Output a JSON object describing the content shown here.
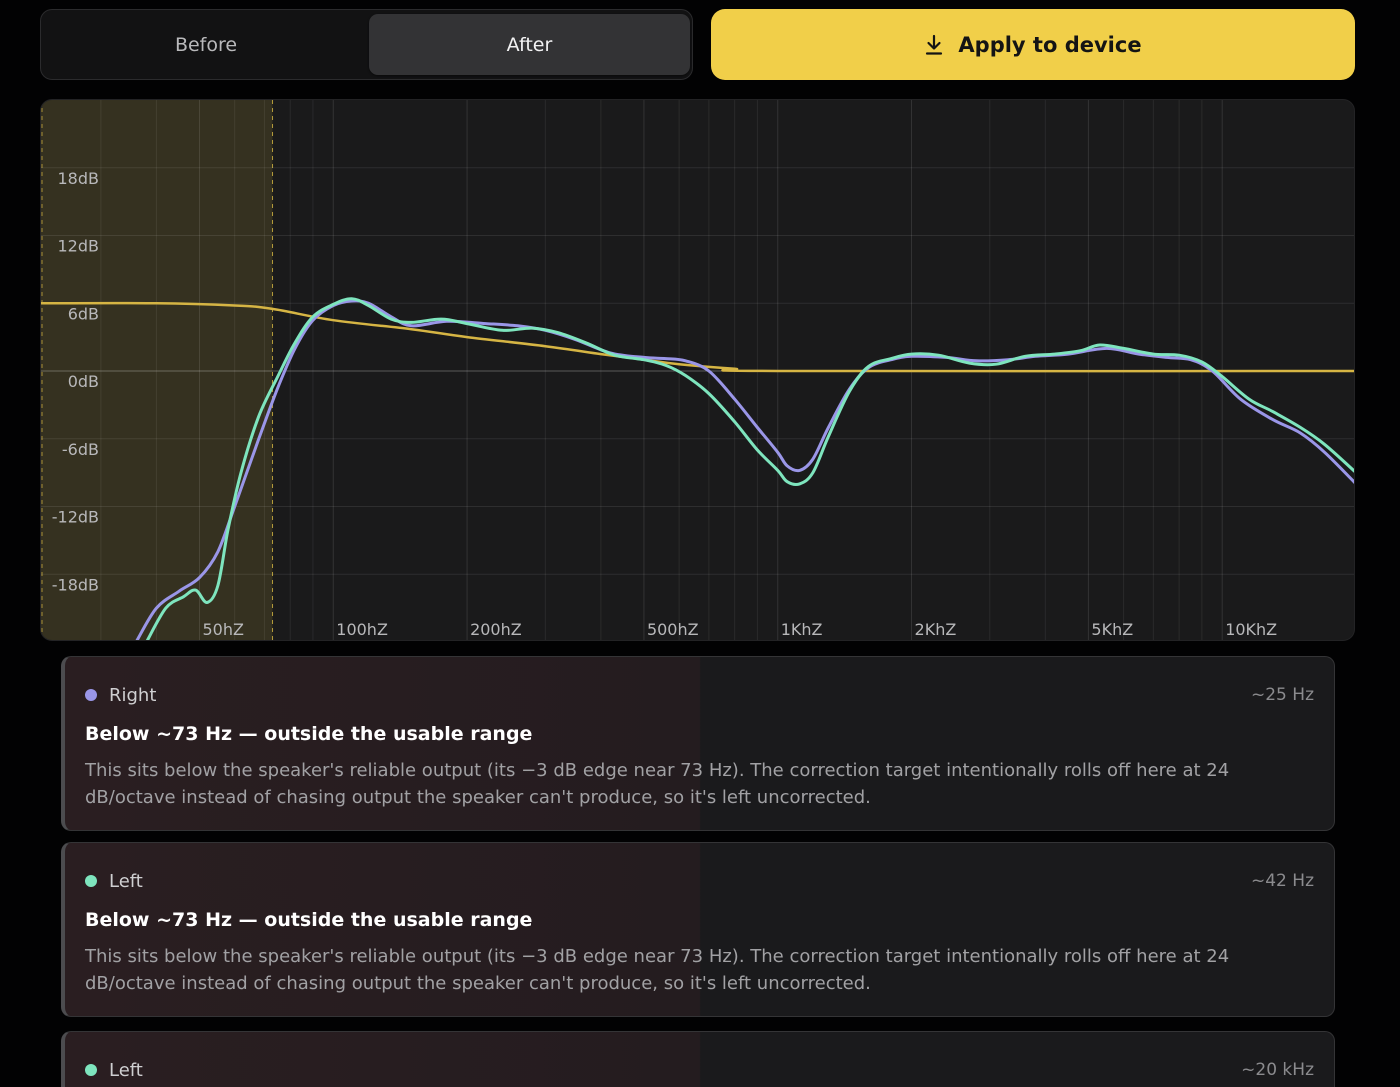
{
  "toggle": {
    "before": "Before",
    "after": "After",
    "selected": "After"
  },
  "apply_button": {
    "label": "Apply to device",
    "icon": "download-icon",
    "color": "#f1cf49"
  },
  "chart_data": {
    "type": "line",
    "x_scale": "log",
    "xlim": [
      22,
      20000
    ],
    "ylim": [
      -24,
      24
    ],
    "y_ticks": [
      {
        "value": 18,
        "label": "18dB"
      },
      {
        "value": 12,
        "label": "12dB"
      },
      {
        "value": 6,
        "label": "6dB"
      },
      {
        "value": 0,
        "label": "0dB"
      },
      {
        "value": -6,
        "label": "-6dB"
      },
      {
        "value": -12,
        "label": "-12dB"
      },
      {
        "value": -18,
        "label": "-18dB"
      }
    ],
    "x_ticks": [
      {
        "value": 50,
        "label": "50hZ"
      },
      {
        "value": 100,
        "label": "100hZ"
      },
      {
        "value": 200,
        "label": "200hZ"
      },
      {
        "value": 500,
        "label": "500hZ"
      },
      {
        "value": 1000,
        "label": "1KhZ"
      },
      {
        "value": 2000,
        "label": "2KhZ"
      },
      {
        "value": 5000,
        "label": "5KhZ"
      },
      {
        "value": 10000,
        "label": "10KhZ"
      }
    ],
    "minor_grid": [
      30,
      40,
      60,
      70,
      80,
      90,
      300,
      400,
      600,
      700,
      800,
      900,
      3000,
      4000,
      6000,
      7000,
      8000,
      9000
    ],
    "grid": true,
    "shaded_region": {
      "from": 22,
      "to": 73,
      "color": "#f1cf49"
    },
    "series": [
      {
        "color": "#d6b544",
        "points": [
          [
            22,
            6
          ],
          [
            40,
            6
          ],
          [
            60,
            5.8
          ],
          [
            73,
            5.5
          ],
          [
            100,
            4.5
          ],
          [
            150,
            3.7
          ],
          [
            200,
            3.0
          ],
          [
            300,
            2.2
          ],
          [
            400,
            1.5
          ],
          [
            500,
            1.0
          ],
          [
            600,
            0.6
          ],
          [
            800,
            0.2
          ],
          [
            1000,
            0
          ],
          [
            20000,
            0
          ]
        ]
      },
      {
        "color": "#9a96e8",
        "points": [
          [
            36,
            -24
          ],
          [
            40,
            -21
          ],
          [
            45,
            -19.5
          ],
          [
            50,
            -18.3
          ],
          [
            55,
            -16
          ],
          [
            60,
            -12
          ],
          [
            68,
            -6
          ],
          [
            75,
            -1.5
          ],
          [
            82,
            2
          ],
          [
            90,
            4.5
          ],
          [
            100,
            5.8
          ],
          [
            110,
            6.2
          ],
          [
            120,
            6.0
          ],
          [
            135,
            4.8
          ],
          [
            150,
            4.0
          ],
          [
            180,
            4.4
          ],
          [
            220,
            4.2
          ],
          [
            260,
            4.0
          ],
          [
            300,
            3.6
          ],
          [
            350,
            2.8
          ],
          [
            420,
            1.6
          ],
          [
            500,
            1.2
          ],
          [
            560,
            1.1
          ],
          [
            620,
            0.9
          ],
          [
            700,
            0
          ],
          [
            800,
            -2.5
          ],
          [
            900,
            -5
          ],
          [
            1000,
            -7.2
          ],
          [
            1050,
            -8.4
          ],
          [
            1120,
            -8.8
          ],
          [
            1200,
            -7.8
          ],
          [
            1300,
            -5
          ],
          [
            1450,
            -1.6
          ],
          [
            1600,
            0.3
          ],
          [
            1800,
            1.0
          ],
          [
            2000,
            1.3
          ],
          [
            2400,
            1.2
          ],
          [
            2800,
            0.9
          ],
          [
            3300,
            1.0
          ],
          [
            3800,
            1.3
          ],
          [
            4500,
            1.5
          ],
          [
            5500,
            2.0
          ],
          [
            6500,
            1.5
          ],
          [
            7500,
            1.2
          ],
          [
            8500,
            1.0
          ],
          [
            9500,
            0
          ],
          [
            11000,
            -2.5
          ],
          [
            13000,
            -4.3
          ],
          [
            15000,
            -5.5
          ],
          [
            17000,
            -7.2
          ],
          [
            20000,
            -10
          ]
        ]
      },
      {
        "color": "#7ee5be",
        "points": [
          [
            38,
            -24
          ],
          [
            42,
            -21
          ],
          [
            46,
            -20
          ],
          [
            49,
            -19.4
          ],
          [
            52,
            -20.5
          ],
          [
            55,
            -19
          ],
          [
            58,
            -14
          ],
          [
            62,
            -9
          ],
          [
            68,
            -4
          ],
          [
            75,
            -0.5
          ],
          [
            82,
            2.5
          ],
          [
            90,
            4.8
          ],
          [
            100,
            5.9
          ],
          [
            110,
            6.4
          ],
          [
            120,
            5.8
          ],
          [
            135,
            4.6
          ],
          [
            150,
            4.3
          ],
          [
            175,
            4.6
          ],
          [
            200,
            4.2
          ],
          [
            240,
            3.6
          ],
          [
            280,
            3.8
          ],
          [
            320,
            3.4
          ],
          [
            370,
            2.5
          ],
          [
            430,
            1.4
          ],
          [
            500,
            1.0
          ],
          [
            560,
            0.5
          ],
          [
            620,
            -0.4
          ],
          [
            700,
            -2
          ],
          [
            800,
            -4.5
          ],
          [
            900,
            -7
          ],
          [
            1000,
            -8.8
          ],
          [
            1050,
            -9.8
          ],
          [
            1120,
            -10
          ],
          [
            1200,
            -9
          ],
          [
            1300,
            -5.8
          ],
          [
            1450,
            -1.8
          ],
          [
            1600,
            0.4
          ],
          [
            1800,
            1.1
          ],
          [
            2000,
            1.5
          ],
          [
            2300,
            1.4
          ],
          [
            2700,
            0.7
          ],
          [
            3100,
            0.6
          ],
          [
            3600,
            1.3
          ],
          [
            4200,
            1.5
          ],
          [
            4800,
            1.8
          ],
          [
            5300,
            2.3
          ],
          [
            6000,
            2.0
          ],
          [
            7000,
            1.5
          ],
          [
            8000,
            1.4
          ],
          [
            9000,
            0.8
          ],
          [
            10000,
            -0.5
          ],
          [
            11500,
            -2.5
          ],
          [
            13000,
            -3.6
          ],
          [
            15000,
            -5
          ],
          [
            17000,
            -6.5
          ],
          [
            20000,
            -9
          ]
        ]
      }
    ]
  },
  "notes": [
    {
      "channel": "Right",
      "dot_color": "#9a96e8",
      "freq": "~25 Hz",
      "title": "Below ~73 Hz — outside the usable range",
      "body": "This sits below the speaker's reliable output (its −3 dB edge near 73 Hz). The correction target intentionally rolls off here at 24 dB/octave instead of chasing output the speaker can't produce, so it's left uncorrected."
    },
    {
      "channel": "Left",
      "dot_color": "#7ee5be",
      "freq": "~42 Hz",
      "title": "Below ~73 Hz — outside the usable range",
      "body": "This sits below the speaker's reliable output (its −3 dB edge near 73 Hz). The correction target intentionally rolls off here at 24 dB/octave instead of chasing output the speaker can't produce, so it's left uncorrected."
    },
    {
      "channel": "Left",
      "dot_color": "#7ee5be",
      "freq": "~20 kHz"
    }
  ]
}
